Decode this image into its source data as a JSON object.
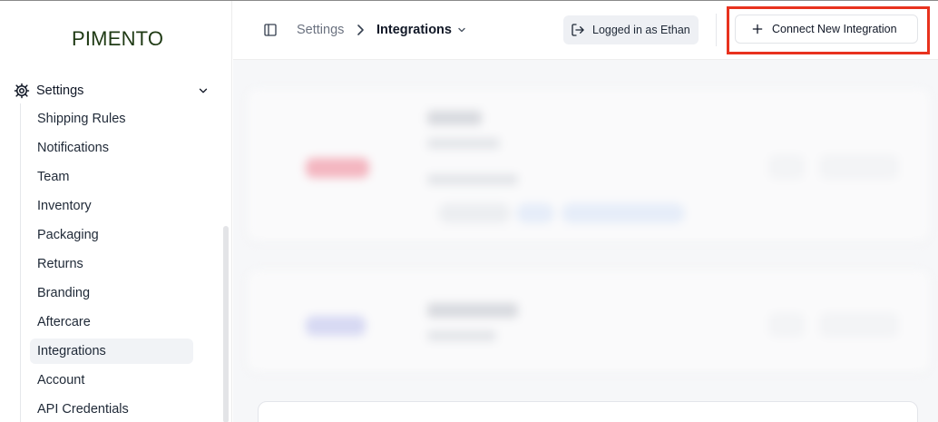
{
  "app": {
    "logo_text": "PIMENTO"
  },
  "sidebar": {
    "section_label": "Settings",
    "items": [
      {
        "label": "Shipping Rules",
        "active": false
      },
      {
        "label": "Notifications",
        "active": false
      },
      {
        "label": "Team",
        "active": false
      },
      {
        "label": "Inventory",
        "active": false
      },
      {
        "label": "Packaging",
        "active": false
      },
      {
        "label": "Returns",
        "active": false
      },
      {
        "label": "Branding",
        "active": false
      },
      {
        "label": "Aftercare",
        "active": false
      },
      {
        "label": "Integrations",
        "active": true
      },
      {
        "label": "Account",
        "active": false
      },
      {
        "label": "API Credentials",
        "active": false
      }
    ]
  },
  "header": {
    "breadcrumb": {
      "parent": "Settings",
      "current": "Integrations"
    },
    "logged_in_label": "Logged in as Ethan",
    "connect_button_label": "Connect New Integration"
  },
  "icons": {
    "settings": "gear-icon",
    "collapse": "chevron-down-icon",
    "sidebar_toggle": "panel-left-icon",
    "breadcrumb_separator": "chevron-right-icon",
    "dropdown": "chevron-down-icon",
    "logout": "log-out-icon",
    "add": "plus-icon"
  },
  "colors": {
    "highlight": "#e8321e",
    "logo": "#1f3a14",
    "active_nav_bg": "#f1f3f6"
  }
}
